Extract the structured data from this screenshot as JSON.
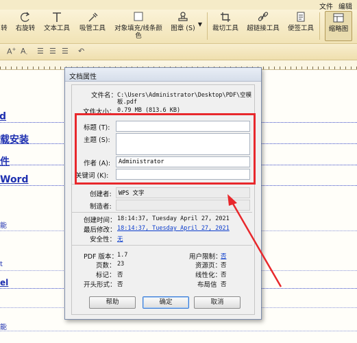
{
  "menubar": {
    "file": "文件",
    "edit": "编辑"
  },
  "ribbon": {
    "rotate_left": "转",
    "rotate_right": "右旋转",
    "text_tool": "文本工具",
    "eyedropper": "吸管工具",
    "fill_color": [
      "对象填充/线条颜",
      "色"
    ],
    "stamp": "图章 (S)",
    "crop": "裁切工具",
    "hyperlink": "超链接工具",
    "note": "便签工具",
    "thumbnail": "缩略图"
  },
  "doc_fragments": [
    "d",
    "载安装",
    "件",
    "Word",
    "能",
    "t",
    "el",
    "能"
  ],
  "dialog": {
    "title": "文档属性",
    "file_name_label": "文件名：",
    "file_name_value": [
      "C:\\Users\\Administrator\\Desktop\\PDF\\空模",
      "板.pdf"
    ],
    "file_size_label": "文件大小：",
    "file_size_value": "0.79 MB (813.6 KB)",
    "fields": {
      "title_label": "标题 (T):",
      "title_value": "",
      "subject_label": "主题 (S):",
      "subject_value": "",
      "author_label": "作者 (A):",
      "author_value": "Administrator",
      "keywords_label": "关键词 (K):",
      "keywords_value": ""
    },
    "creator_label": "创建者:",
    "creator_value": "WPS 文字",
    "producer_label": "制造者:",
    "producer_value": "",
    "created_label": "创建时间：",
    "created_value": "18:14:37, Tuesday April 27, 2021",
    "modified_label": "最后修改：",
    "modified_value": "18:14:37, Tuesday April 27, 2021",
    "security_label": "安全性：",
    "security_value": "无",
    "pdf_version_label": "PDF 版本：",
    "pdf_version_value": "1.7",
    "pages_label": "页数：",
    "pages_value": "23",
    "tagged_label": "标记：",
    "tagged_value": "否",
    "opening_label": "开头形式：",
    "opening_value": "否",
    "user_restrict_label": "用户限制：",
    "user_restrict_value": "否",
    "resources_label": "资源页：",
    "resources_value": "否",
    "linearized_label": "线性化：",
    "linearized_value": "否",
    "layout_label": "布局信",
    "layout_value": "否",
    "help_button": "帮助",
    "ok_button": "确定",
    "cancel_button": "取消"
  },
  "colors": {
    "annotation_red": "#e8282c",
    "link_blue": "#0a3ccc",
    "doc_text_blue": "#1d2fb0"
  }
}
